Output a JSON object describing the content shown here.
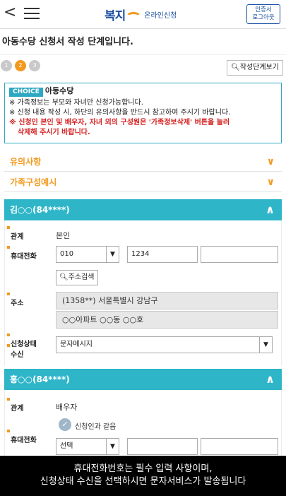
{
  "header": {
    "back": "<",
    "brand": "복지",
    "sub": "온라인신청",
    "login_line1": "인증서",
    "login_line2": "로그아웃"
  },
  "page_title": "아동수당 신청서 작성 단계입니다.",
  "steps": [
    "1",
    "2",
    "3"
  ],
  "step_view": "작성단계보기",
  "notice": {
    "badge": "CHOICE",
    "title": "아동수당",
    "line1": "※ 가족정보는 부모와 자녀만 신청가능합니다.",
    "line2": "※ 신청 내용 작성 시, 하단의 유의사항을 반드시 참고하여 주시기 바랍니다.",
    "line3a": "※ 신청인 본인 및 배우자, 자녀 외의 구성원은 '가족정보삭제' 버튼을 눌러",
    "line3b": "삭제해 주시기 바랍니다."
  },
  "accordions": [
    "유의사항",
    "가족구성예시"
  ],
  "member1": {
    "name": "김○○(84****)",
    "rel_label": "관계",
    "rel_value": "본인",
    "phone_label": "휴대전화",
    "phone1": "010",
    "phone2": "1234",
    "phone3": "",
    "search_btn": "주소검색",
    "addr_label": "주소",
    "addr1": "(1358**) 서울특별시 강남구",
    "addr2": "○○아파트 ○○동 ○○호",
    "status_label1": "신청상태",
    "status_label2": "수신",
    "status_value": "문자메시지"
  },
  "member2": {
    "name": "홍○○(84****)",
    "rel_label": "관계",
    "rel_value": "배우자",
    "same_label": "신청인과 같음",
    "phone_label": "휴대전화",
    "phone1": "선택"
  },
  "caption": {
    "line1": "휴대전화번호는 필수 입력 사항이며,",
    "line2": "신청상태 수신을 선택하시면 문자서비스가 발송됩니다"
  }
}
